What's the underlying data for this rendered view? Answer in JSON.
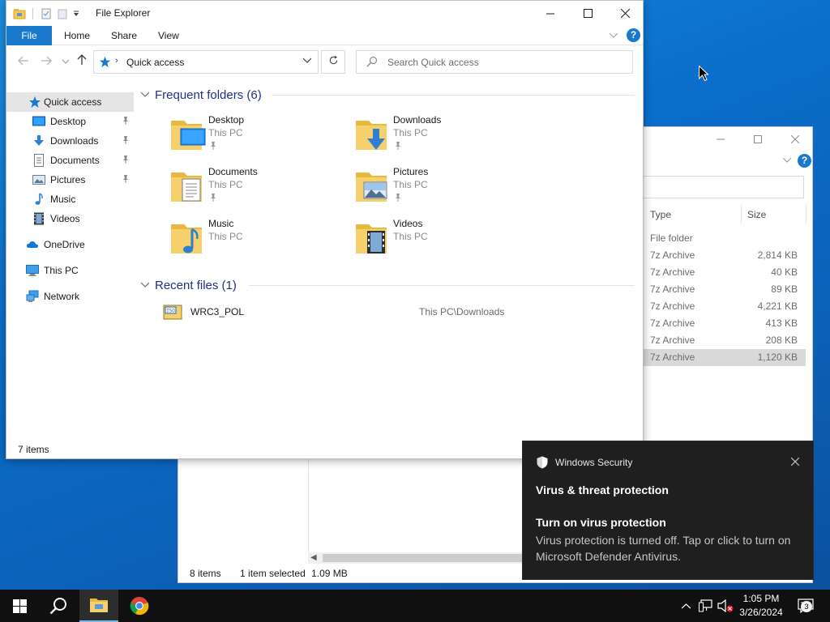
{
  "main_window": {
    "title": "File Explorer",
    "ribbon": {
      "file": "File",
      "home": "Home",
      "share": "Share",
      "view": "View"
    },
    "address": {
      "location": "Quick access"
    },
    "search": {
      "placeholder": "Search Quick access"
    },
    "nav_pane": [
      {
        "label": "Quick access",
        "icon": "star-icon",
        "selected": true
      },
      {
        "label": "Desktop",
        "icon": "desktop-icon",
        "pinned": true
      },
      {
        "label": "Downloads",
        "icon": "download-arrow-icon",
        "pinned": true
      },
      {
        "label": "Documents",
        "icon": "document-icon",
        "pinned": true
      },
      {
        "label": "Pictures",
        "icon": "pictures-icon",
        "pinned": true
      },
      {
        "label": "Music",
        "icon": "music-note-icon"
      },
      {
        "label": "Videos",
        "icon": "film-icon"
      },
      {
        "label": "OneDrive",
        "icon": "cloud-icon"
      },
      {
        "label": "This PC",
        "icon": "computer-icon"
      },
      {
        "label": "Network",
        "icon": "network-icon"
      }
    ],
    "frequent": {
      "header": "Frequent folders (6)",
      "items": [
        {
          "name": "Desktop",
          "location": "This PC",
          "pinned": true
        },
        {
          "name": "Downloads",
          "location": "This PC",
          "pinned": true
        },
        {
          "name": "Documents",
          "location": "This PC",
          "pinned": true
        },
        {
          "name": "Pictures",
          "location": "This PC",
          "pinned": true
        },
        {
          "name": "Music",
          "location": "This PC"
        },
        {
          "name": "Videos",
          "location": "This PC"
        }
      ]
    },
    "recent": {
      "header": "Recent files (1)",
      "items": [
        {
          "name": "WRC3_POL",
          "path": "This PC\\Downloads",
          "icon_text": "ISO"
        }
      ]
    },
    "status": "7 items"
  },
  "background_window": {
    "columns": {
      "type": "Type",
      "size": "Size"
    },
    "rows": [
      {
        "type": "File folder",
        "size": ""
      },
      {
        "type": "7z Archive",
        "size": "2,814 KB"
      },
      {
        "type": "7z Archive",
        "size": "40 KB"
      },
      {
        "type": "7z Archive",
        "size": "89 KB"
      },
      {
        "type": "7z Archive",
        "size": "4,221 KB"
      },
      {
        "type": "7z Archive",
        "size": "413 KB"
      },
      {
        "type": "7z Archive",
        "size": "208 KB"
      },
      {
        "type": "7z Archive",
        "size": "1,120 KB",
        "selected": true
      }
    ],
    "status": {
      "items": "8 items",
      "selected": "1 item selected",
      "size": "1.09 MB"
    }
  },
  "toast": {
    "app": "Windows Security",
    "title": "Virus & threat protection",
    "subtitle": "Turn on virus protection",
    "body": "Virus protection is turned off. Tap or click to turn on Microsoft Defender Antivirus."
  },
  "taskbar": {
    "time": "1:05 PM",
    "date": "3/26/2024",
    "notification_count": "3"
  },
  "colors": {
    "accent": "#1979ca",
    "section_header": "#1e3287",
    "toast_bg": "#1f1f1f",
    "taskbar_bg": "#101010",
    "folder_yellow": "#f6c955"
  }
}
